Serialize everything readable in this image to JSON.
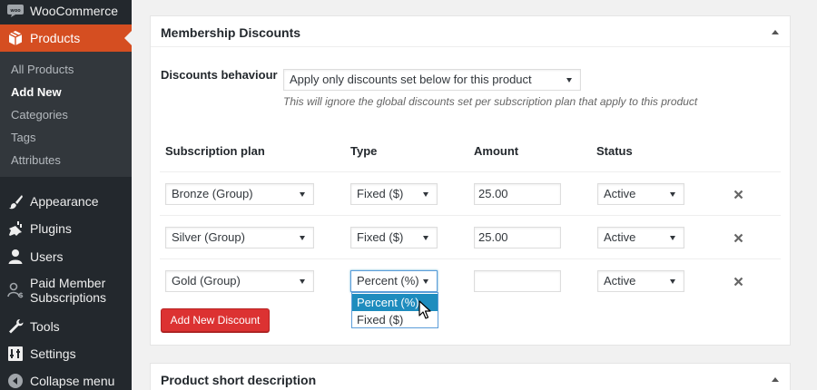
{
  "sidebar": {
    "top_item": {
      "label": "WooCommerce",
      "icon": "woo-icon"
    },
    "active_item": {
      "label": "Products",
      "icon": "box-icon"
    },
    "submenu": [
      "All Products",
      "Add New",
      "Categories",
      "Tags",
      "Attributes"
    ],
    "current_submenu": "Add New",
    "items": [
      {
        "label": "Appearance",
        "icon": "paintbrush-icon"
      },
      {
        "label": "Plugins",
        "icon": "plug-icon"
      },
      {
        "label": "Users",
        "icon": "user-icon"
      },
      {
        "label": "Paid Member Subscriptions",
        "label_lines": [
          "Paid Member",
          "Subscriptions"
        ],
        "icon": "member-icon"
      },
      {
        "label": "Tools",
        "icon": "wrench-icon"
      },
      {
        "label": "Settings",
        "icon": "settings-icon"
      },
      {
        "label": "Collapse menu",
        "icon": "collapse-icon"
      }
    ]
  },
  "discounts_panel": {
    "title": "Membership Discounts",
    "behaviour_label": "Discounts behaviour",
    "behaviour_value": "Apply only discounts set below for this product",
    "behaviour_hint": "This will ignore the global discounts set per subscription plan that apply to this product",
    "columns": [
      "Subscription plan",
      "Type",
      "Amount",
      "Status"
    ],
    "rows": [
      {
        "plan": "Bronze (Group)",
        "type": "Fixed ($)",
        "amount": "25.00",
        "status": "Active"
      },
      {
        "plan": "Silver (Group)",
        "type": "Fixed ($)",
        "amount": "25.00",
        "status": "Active"
      },
      {
        "plan": "Gold (Group)",
        "type": "Percent (%)",
        "amount": "",
        "status": "Active"
      }
    ],
    "type_dropdown_options": [
      "Percent (%)",
      "Fixed ($)"
    ],
    "type_dropdown_highlighted": "Percent (%)",
    "add_button": "Add New Discount"
  },
  "short_desc_panel": {
    "title": "Product short description"
  },
  "colors": {
    "sidebar_bg": "#23282d",
    "submenu_bg": "#32373c",
    "active_menu": "#d54e21",
    "add_button": "#dc3232",
    "dropdown_highlight": "#1e8cbe",
    "focus_border": "#5b9dd9"
  }
}
